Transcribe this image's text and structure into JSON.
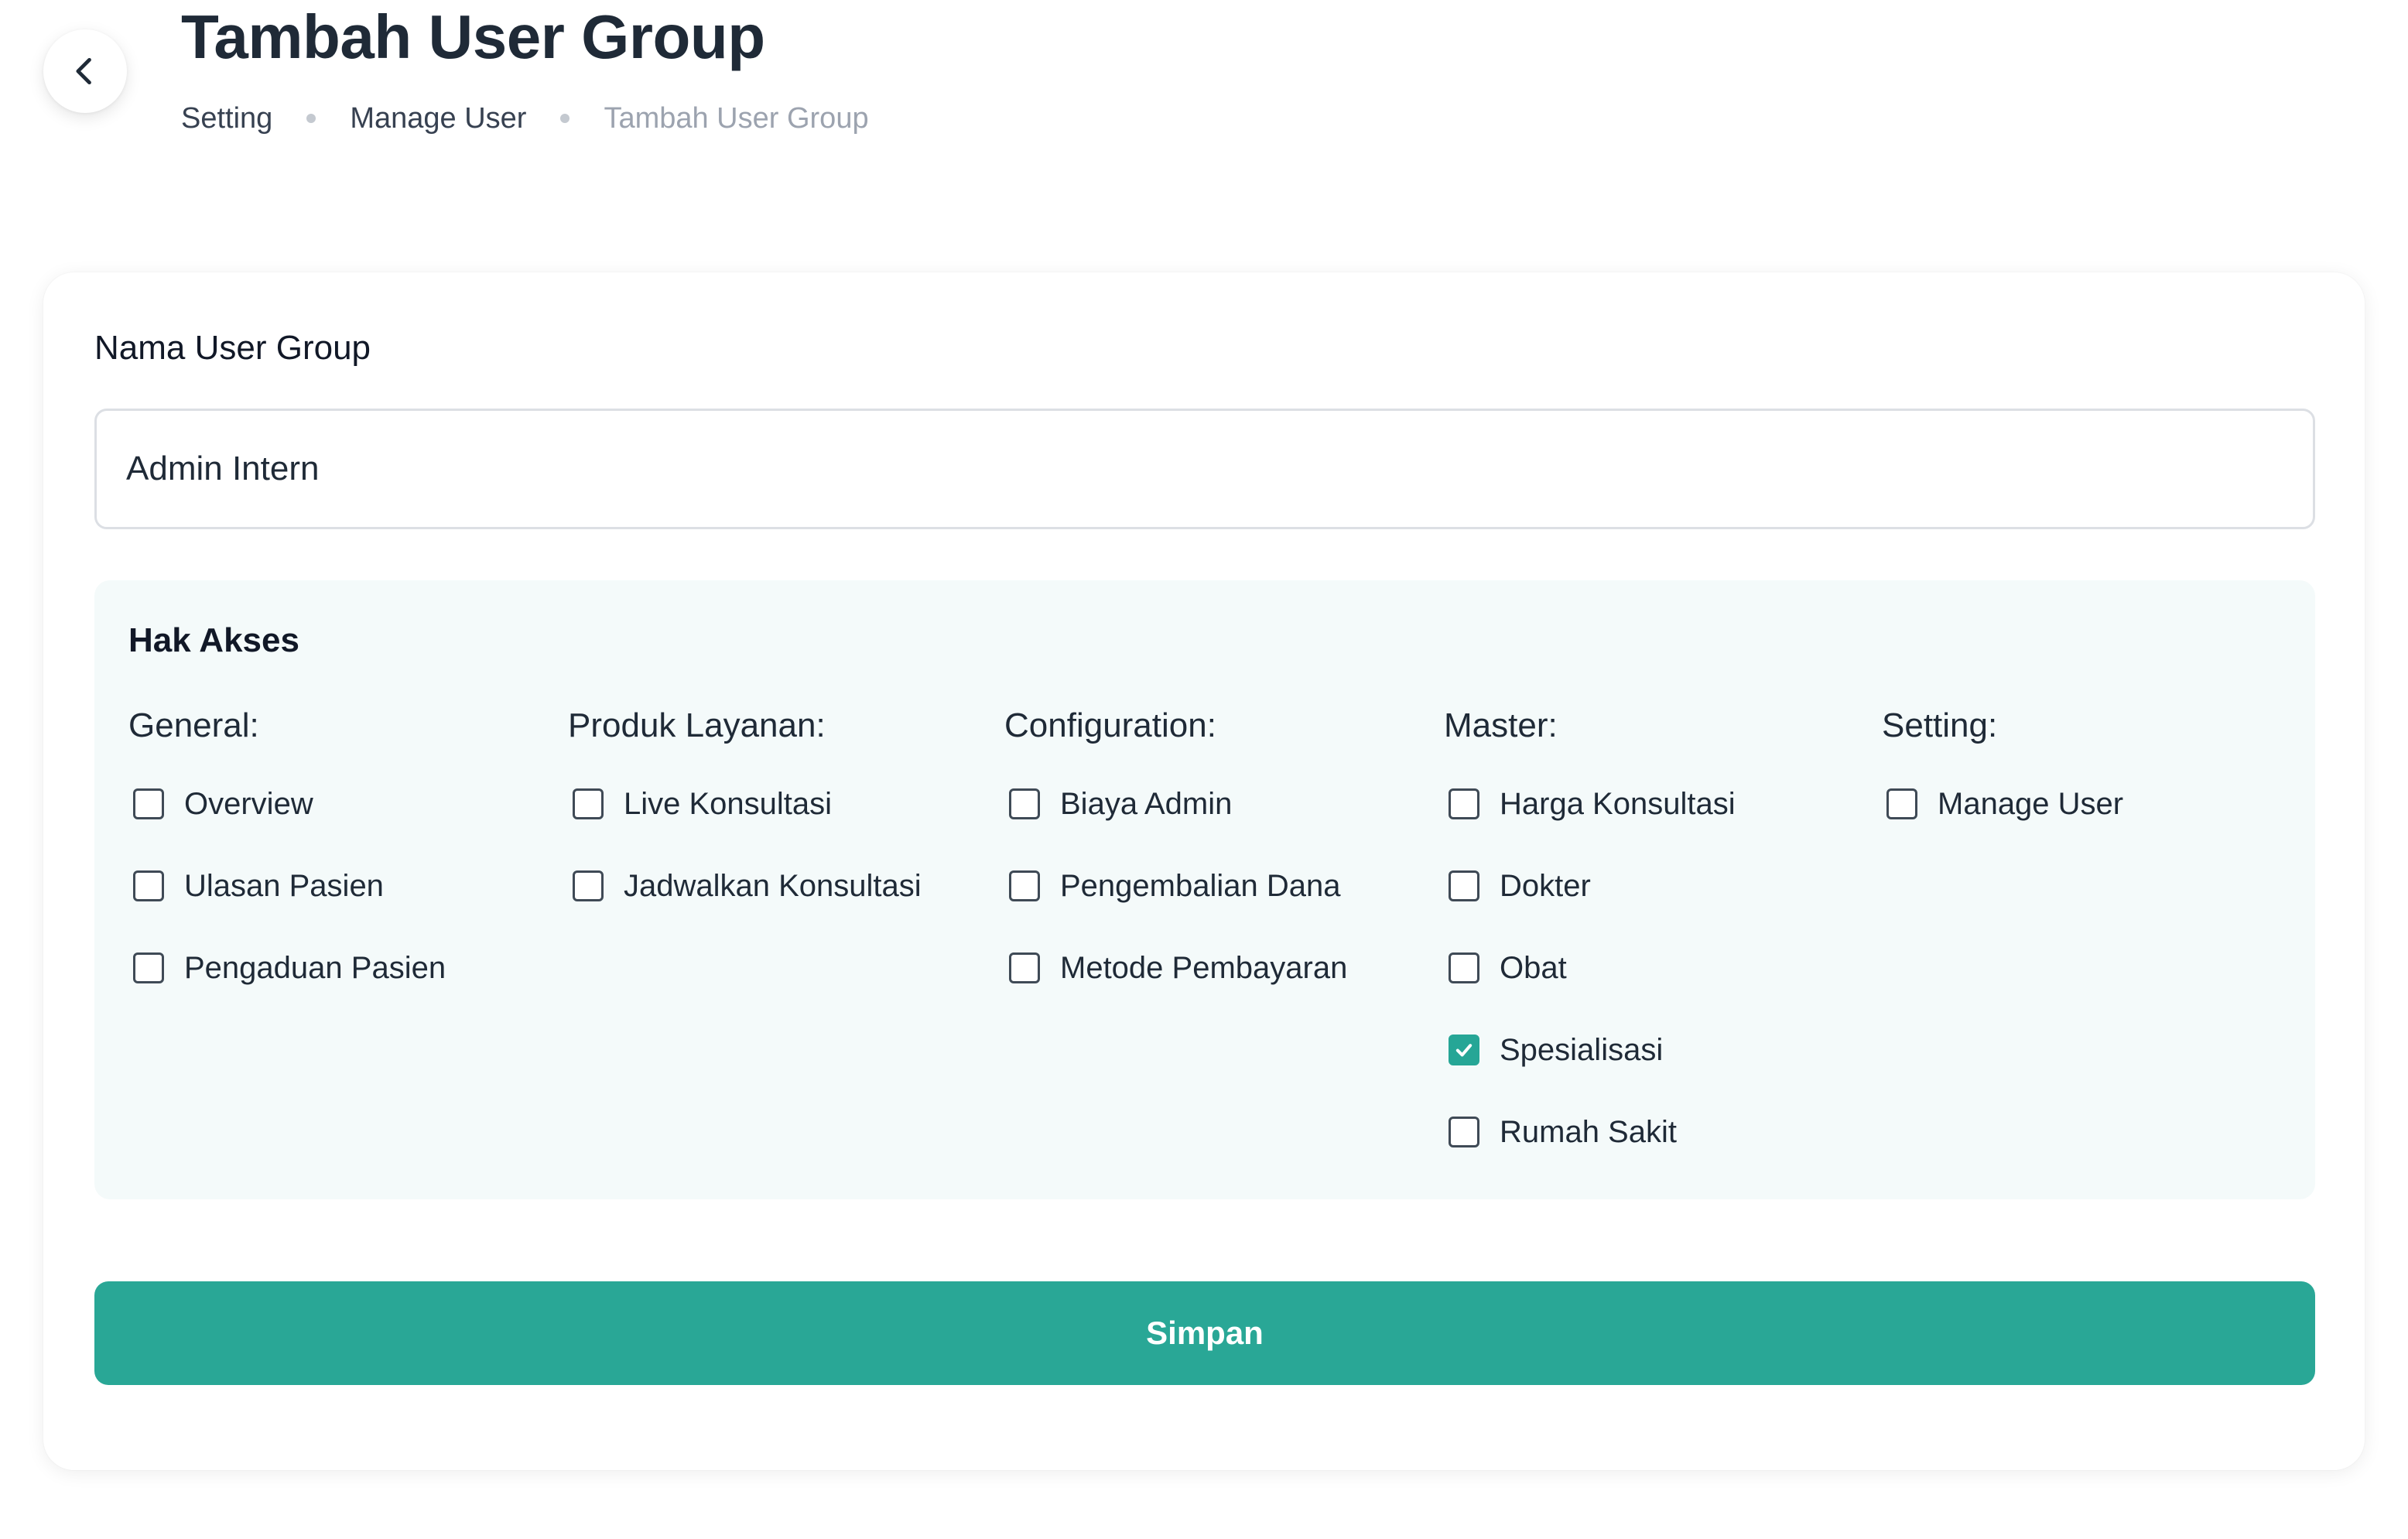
{
  "header": {
    "title": "Tambah User Group",
    "breadcrumb": [
      "Setting",
      "Manage User",
      "Tambah User Group"
    ]
  },
  "form": {
    "name_label": "Nama User Group",
    "name_value": "Admin Intern"
  },
  "access": {
    "title": "Hak Akses",
    "groups": [
      {
        "title": "General:",
        "options": [
          {
            "label": "Overview",
            "checked": false
          },
          {
            "label": "Ulasan Pasien",
            "checked": false
          },
          {
            "label": "Pengaduan Pasien",
            "checked": false
          }
        ]
      },
      {
        "title": "Produk Layanan:",
        "options": [
          {
            "label": "Live Konsultasi",
            "checked": false
          },
          {
            "label": "Jadwalkan Konsultasi",
            "checked": false
          }
        ]
      },
      {
        "title": "Configuration:",
        "options": [
          {
            "label": "Biaya Admin",
            "checked": false
          },
          {
            "label": "Pengembalian Dana",
            "checked": false
          },
          {
            "label": "Metode Pembayaran",
            "checked": false
          }
        ]
      },
      {
        "title": "Master:",
        "options": [
          {
            "label": "Harga Konsultasi",
            "checked": false
          },
          {
            "label": "Dokter",
            "checked": false
          },
          {
            "label": "Obat",
            "checked": false
          },
          {
            "label": "Spesialisasi",
            "checked": true
          },
          {
            "label": "Rumah Sakit",
            "checked": false
          }
        ]
      },
      {
        "title": "Setting:",
        "options": [
          {
            "label": "Manage User",
            "checked": false
          }
        ]
      }
    ]
  },
  "actions": {
    "save_label": "Simpan"
  },
  "icons": {
    "back": "chevron-left-icon",
    "checked": "checkmark-icon"
  },
  "colors": {
    "primary": "#29a796",
    "panel_bg": "#f4fafa",
    "text": "#1f2a37",
    "muted": "#9ca3af"
  }
}
